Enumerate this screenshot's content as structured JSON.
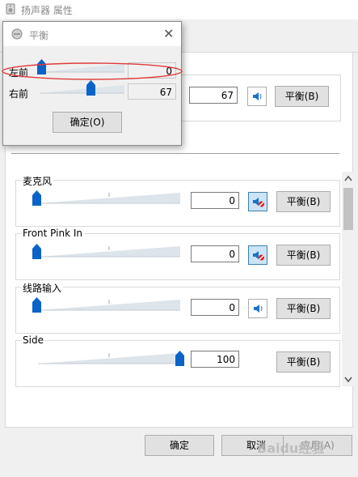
{
  "window": {
    "title": "扬声器 属性"
  },
  "output": {
    "value": "67",
    "balance_label": "平衡(B)"
  },
  "rows": [
    {
      "label": "麦克风",
      "value": "0",
      "muted": true,
      "balance_label": "平衡(B)",
      "level": 0
    },
    {
      "label": "Front Pink In",
      "value": "0",
      "muted": true,
      "balance_label": "平衡(B)",
      "level": 0
    },
    {
      "label": "线路输入",
      "value": "0",
      "muted": false,
      "balance_label": "平衡(B)",
      "level": 0
    },
    {
      "label": "Side",
      "value": "100",
      "muted": false,
      "balance_label": "平衡(B)",
      "level": 100
    }
  ],
  "dialog": {
    "title": "平衡",
    "rows": [
      {
        "label": "左前",
        "value": "0",
        "level": 0
      },
      {
        "label": "右前",
        "value": "67",
        "level": 67
      }
    ],
    "ok_label": "确定(O)"
  },
  "footer": {
    "ok": "确定",
    "cancel": "取消",
    "apply": "应用(A)"
  },
  "watermark": "Baidu经验",
  "colors": {
    "accent": "#0a64c8",
    "annotation": "#e03a3a"
  }
}
